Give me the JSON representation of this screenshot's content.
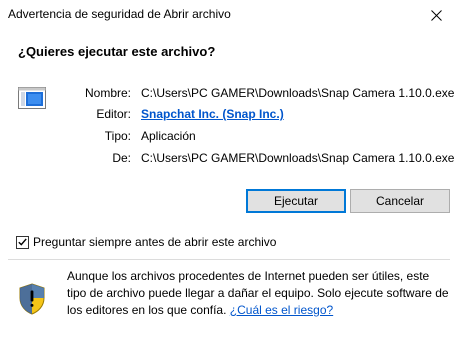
{
  "window": {
    "title": "Advertencia de seguridad de Abrir archivo",
    "close_glyph": "✕"
  },
  "dialog": {
    "question": "¿Quieres ejecutar este archivo?",
    "file_icon": "executable-file-icon",
    "fields": {
      "name_label": "Nombre:",
      "name_value": "C:\\Users\\PC GAMER\\Downloads\\Snap Camera 1.10.0.exe",
      "publisher_label": "Editor:",
      "publisher_value": "Snapchat Inc. (Snap Inc.)",
      "type_label": "Tipo:",
      "type_value": "Aplicación",
      "from_label": "De:",
      "from_value": "C:\\Users\\PC GAMER\\Downloads\\Snap Camera 1.10.0.exe"
    },
    "buttons": {
      "run_label": "Ejecutar",
      "cancel_label": "Cancelar"
    },
    "checkbox": {
      "label": "Preguntar siempre antes de abrir este archivo",
      "checked": true
    },
    "warning": {
      "icon": "shield-warning-icon",
      "line1": "Aunque los archivos procedentes de Internet pueden ser útiles, este",
      "line2": "tipo de archivo puede llegar a dañar el equipo. Solo ejecute software de",
      "line3_prefix": "los editores en los que confía.",
      "risk_link": "¿Cuál es el riesgo?"
    }
  },
  "colors": {
    "link": "#0055cc",
    "default_button_border": "#0078d7",
    "button_background": "#e1e1e1",
    "separator": "#dcdcdc",
    "shield_yellow": "#f5c518"
  }
}
